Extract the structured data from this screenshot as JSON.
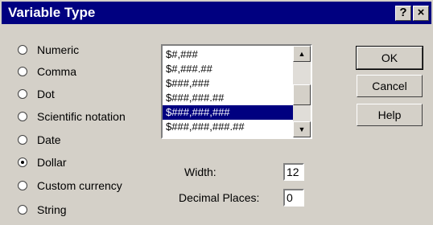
{
  "window": {
    "title": "Variable Type",
    "help_glyph": "?",
    "close_glyph": "×"
  },
  "radios": [
    {
      "label": "Numeric",
      "checked": false
    },
    {
      "label": "Comma",
      "checked": false
    },
    {
      "label": "Dot",
      "checked": false
    },
    {
      "label": "Scientific notation",
      "checked": false
    },
    {
      "label": "Date",
      "checked": false
    },
    {
      "label": "Dollar",
      "checked": true
    },
    {
      "label": "Custom currency",
      "checked": false
    },
    {
      "label": "String",
      "checked": false
    }
  ],
  "formats": {
    "items": [
      "$#,###",
      "$#,###.##",
      "$###,###",
      "$###,###.##",
      "$###,###,###",
      "$###,###,###.##"
    ],
    "selected_index": 4
  },
  "fields": {
    "width_label": "Width:",
    "width_value": "12",
    "decimal_label": "Decimal Places:",
    "decimal_value": "0"
  },
  "buttons": {
    "ok": "OK",
    "cancel": "Cancel",
    "help": "Help"
  }
}
